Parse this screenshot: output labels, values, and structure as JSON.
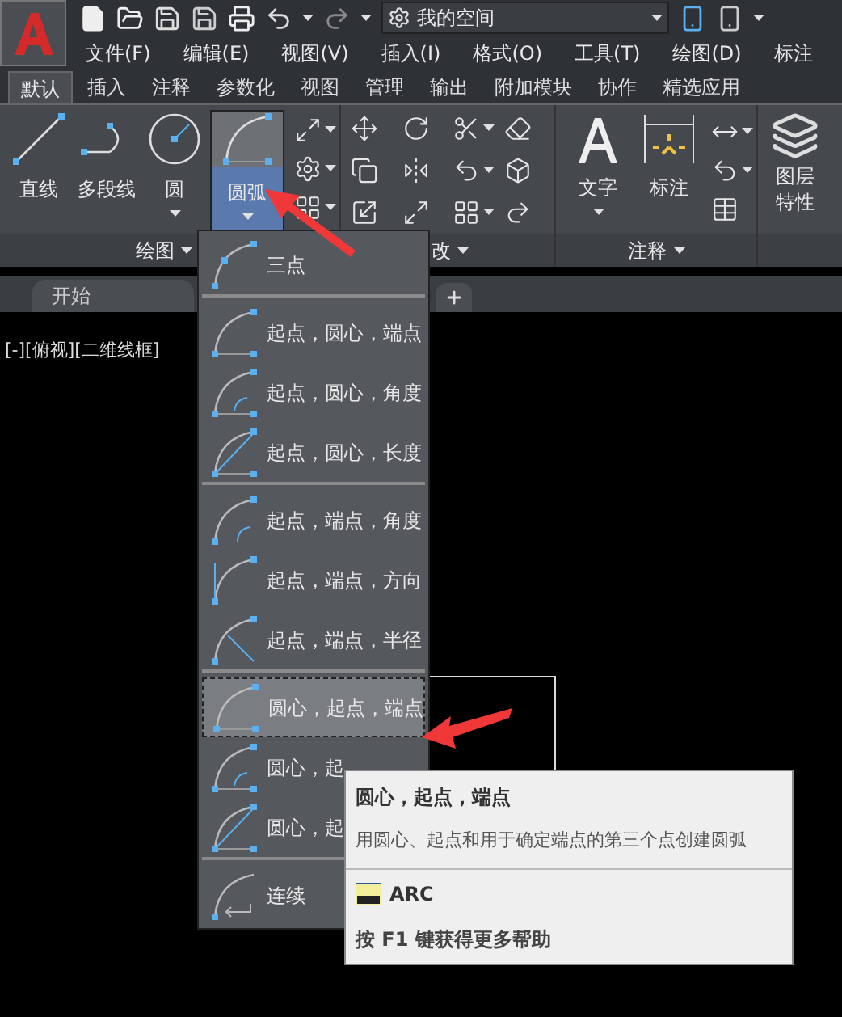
{
  "quick_access": {
    "workspace": "我的空间"
  },
  "menu_bar": [
    "文件(F)",
    "编辑(E)",
    "视图(V)",
    "插入(I)",
    "格式(O)",
    "工具(T)",
    "绘图(D)",
    "标注"
  ],
  "ribbon_tabs": [
    {
      "label": "默认",
      "selected": true
    },
    {
      "label": "插入",
      "selected": false
    },
    {
      "label": "注释",
      "selected": false
    },
    {
      "label": "参数化",
      "selected": false
    },
    {
      "label": "视图",
      "selected": false
    },
    {
      "label": "管理",
      "selected": false
    },
    {
      "label": "输出",
      "selected": false
    },
    {
      "label": "附加模块",
      "selected": false
    },
    {
      "label": "协作",
      "selected": false
    },
    {
      "label": "精选应用",
      "selected": false
    }
  ],
  "ribbon": {
    "draw": {
      "title": "绘图",
      "tools": [
        {
          "label": "直线",
          "dropdown": false,
          "expanded": false
        },
        {
          "label": "多段线",
          "dropdown": false,
          "expanded": false
        },
        {
          "label": "圆",
          "dropdown": true,
          "expanded": false
        },
        {
          "label": "圆弧",
          "dropdown": true,
          "expanded": true
        }
      ]
    },
    "modify": {
      "title": "改"
    },
    "annotation": {
      "title": "注释",
      "tools": [
        {
          "label": "文字",
          "dropdown": true
        },
        {
          "label": "标注",
          "dropdown": false
        }
      ]
    },
    "layers": {
      "tools": [
        {
          "label": "图层特性"
        }
      ]
    }
  },
  "file_tabs": [
    {
      "label": "开始"
    }
  ],
  "viewport_label": "[-][俯视][二维线框]",
  "arc_menu": {
    "groups": [
      {
        "items": [
          {
            "label": "三点",
            "selected": false
          }
        ]
      },
      {
        "items": [
          {
            "label": "起点，圆心，端点",
            "selected": false
          },
          {
            "label": "起点，圆心，角度",
            "selected": false
          },
          {
            "label": "起点，圆心，长度",
            "selected": false
          }
        ]
      },
      {
        "items": [
          {
            "label": "起点，端点，角度",
            "selected": false
          },
          {
            "label": "起点，端点，方向",
            "selected": false
          },
          {
            "label": "起点，端点，半径",
            "selected": false
          }
        ]
      },
      {
        "items": [
          {
            "label": "圆心，起点，端点",
            "selected": true
          },
          {
            "label": "圆心，起",
            "selected": false
          },
          {
            "label": "圆心，起",
            "selected": false
          }
        ]
      },
      {
        "items": [
          {
            "label": "连续",
            "selected": false
          }
        ]
      }
    ]
  },
  "tooltip": {
    "title": "圆心，起点，端点",
    "description": "用圆心、起点和用于确定端点的第三个点创建圆弧",
    "command": "ARC",
    "help": "按 F1 键获得更多帮助"
  }
}
